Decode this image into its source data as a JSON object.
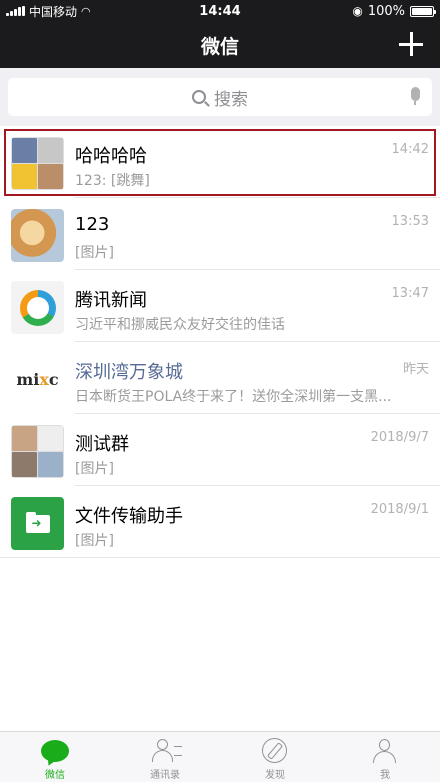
{
  "status_bar": {
    "carrier": "中国移动",
    "time": "14:44",
    "battery": "100%",
    "battery_level": 1.0
  },
  "nav": {
    "title": "微信"
  },
  "search": {
    "placeholder": "搜索"
  },
  "chats": [
    {
      "name": "哈哈哈哈",
      "time": "14:42",
      "preview": "123: [跳舞]",
      "avatar": "group-avatar-icon",
      "selected": true
    },
    {
      "name": "123",
      "time": "13:53",
      "preview": "[图片]",
      "avatar": "doge-avatar-icon"
    },
    {
      "name": "腾讯新闻",
      "time": "13:47",
      "preview": "习近平和挪威民众友好交往的佳话",
      "avatar": "tencent-news-icon"
    },
    {
      "name": "深圳湾万象城",
      "time": "昨天",
      "preview": "日本断货王POLA终于来了！送你全深圳第一支黑...",
      "avatar": "mixc-logo-icon",
      "official": true
    },
    {
      "name": "测试群",
      "time": "2018/9/7",
      "preview": "[图片]",
      "avatar": "group-avatar-icon"
    },
    {
      "name": "文件传输助手",
      "time": "2018/9/1",
      "preview": "[图片]",
      "avatar": "file-transfer-icon"
    }
  ],
  "tabs": [
    {
      "label": "微信",
      "icon": "chat-icon",
      "active": true
    },
    {
      "label": "通讯录",
      "icon": "contacts-icon"
    },
    {
      "label": "发现",
      "icon": "compass-icon"
    },
    {
      "label": "我",
      "icon": "person-icon"
    }
  ],
  "colors": {
    "header_bg": "#1b1b1d",
    "accent_green": "#1aad19",
    "official_name": "#576b95",
    "selection_border": "#a3181e"
  }
}
